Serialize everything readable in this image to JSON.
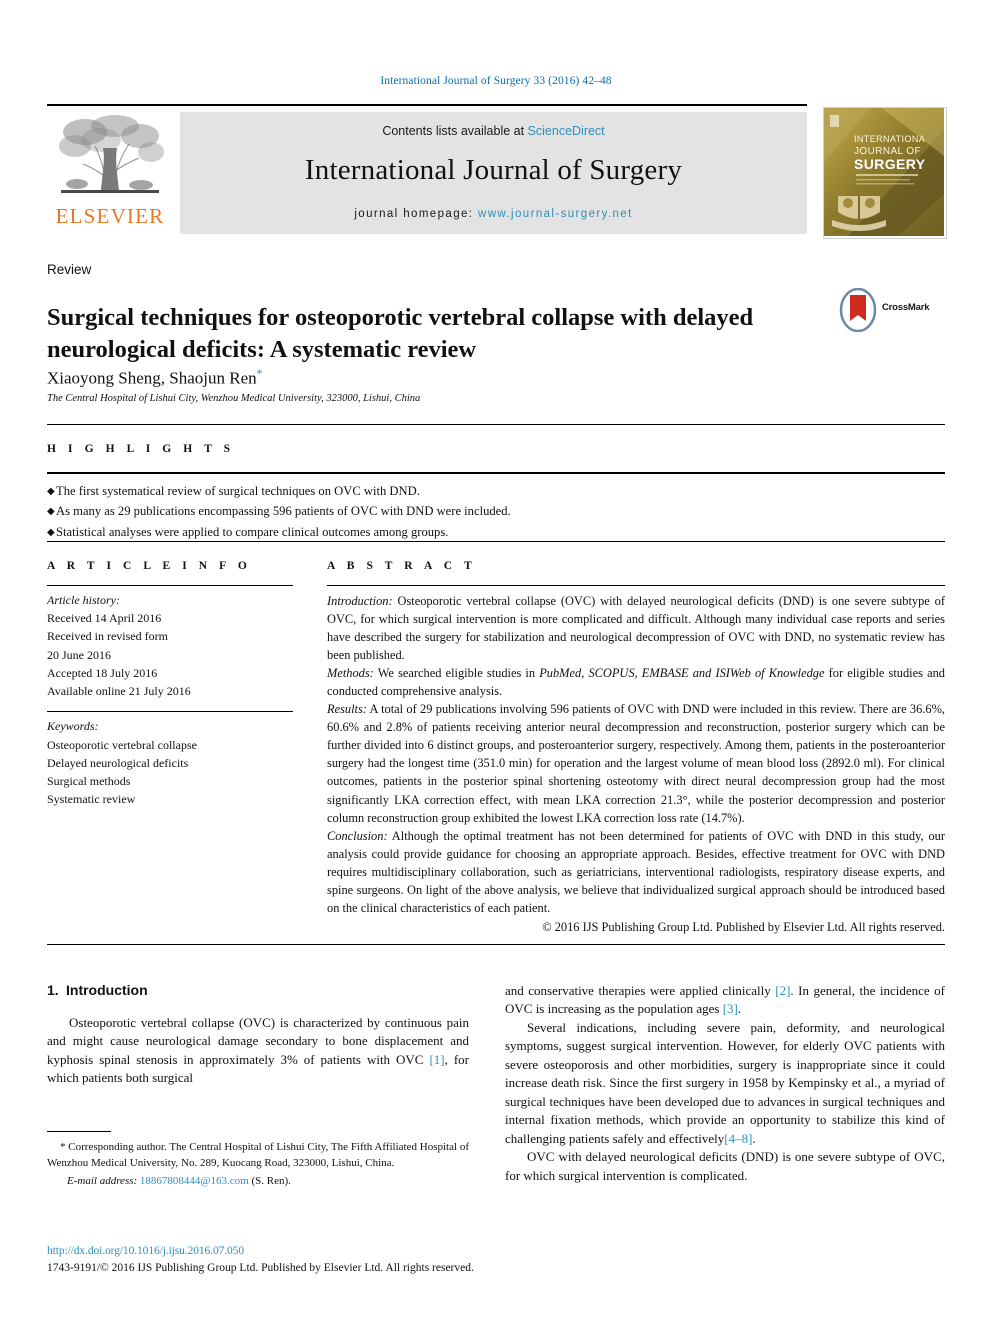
{
  "running_head": "International Journal of Surgery 33 (2016) 42–48",
  "masthead": {
    "contents_prefix": "Contents lists available at ",
    "sciencedirect": "ScienceDirect",
    "journal_title": "International Journal of Surgery",
    "homepage_prefix": "journal homepage: ",
    "homepage_url": "www.journal-surgery.net",
    "publisher_wordmark": "ELSEVIER",
    "publisher_color": "#e87722",
    "link_color": "#2c8fbf",
    "band_color": "#e3e3e3",
    "cover_title_line1": "INTERNATIONAL",
    "cover_title_line2": "JOURNAL OF",
    "cover_title_line3": "SURGERY"
  },
  "article": {
    "section_label": "Review",
    "title": "Surgical techniques for osteoporotic vertebral collapse with delayed neurological deficits: A systematic review",
    "authors": "Xiaoyong Sheng, Shaojun Ren",
    "corresponding_marker": "*",
    "affiliation": "The Central Hospital of Lishui City, Wenzhou Medical University, 323000, Lishui, China",
    "crossmark_label": "CrossMark"
  },
  "highlights": {
    "label": "H I G H L I G H T S",
    "items": [
      "The first systematical review of surgical techniques on OVC with DND.",
      "As many as 29 publications encompassing 596 patients of OVC with DND were included.",
      "Statistical analyses were applied to compare clinical outcomes among groups."
    ]
  },
  "article_info": {
    "label": "A R T I C L E   I N F O",
    "history_label": "Article history:",
    "history": [
      "Received 14 April 2016",
      "Received in revised form",
      "20 June 2016",
      "Accepted 18 July 2016",
      "Available online 21 July 2016"
    ],
    "keywords_label": "Keywords:",
    "keywords": [
      "Osteoporotic vertebral collapse",
      "Delayed neurological deficits",
      "Surgical methods",
      "Systematic review"
    ]
  },
  "abstract": {
    "label": "A B S T R A C T",
    "introduction_label": "Introduction:",
    "introduction_text": " Osteoporotic vertebral collapse (OVC) with delayed neurological deficits (DND) is one severe subtype of OVC, for which surgical intervention is more complicated and difficult. Although many individual case reports and series have described the surgery for stabilization and neurological decompression of OVC with DND, no systematic review has been published.",
    "methods_label": "Methods:",
    "methods_text_a": " We searched eligible studies in ",
    "methods_databases": "PubMed, SCOPUS, EMBASE and ISIWeb of Knowledge",
    "methods_text_b": " for eligible studies and conducted comprehensive analysis.",
    "results_label": "Results:",
    "results_text": " A total of 29 publications involving 596 patients of OVC with DND were included in this review. There are 36.6%, 60.6% and 2.8% of patients receiving anterior neural decompression and reconstruction, posterior surgery which can be further divided into 6 distinct groups, and posteroanterior surgery, respectively. Among them, patients in the posteroanterior surgery had the longest time (351.0 min) for operation and the largest volume of mean blood loss (2892.0 ml). For clinical outcomes, patients in the posterior spinal shortening osteotomy with direct neural decompression group had the most significantly LKA correction effect, with mean LKA correction 21.3°, while the posterior decompression and posterior column reconstruction group exhibited the lowest LKA correction loss rate (14.7%).",
    "conclusion_label": "Conclusion:",
    "conclusion_text": " Although the optimal treatment has not been determined for patients of OVC with DND in this study, our analysis could provide guidance for choosing an appropriate approach. Besides, effective treatment for OVC with DND requires multidisciplinary collaboration, such as geriatricians, interventional radiologists, respiratory disease experts, and spine surgeons. On light of the above analysis, we believe that individualized surgical approach should be introduced based on the clinical characteristics of each patient.",
    "copyright": "© 2016 IJS Publishing Group Ltd. Published by Elsevier Ltd. All rights reserved."
  },
  "body": {
    "intro_number": "1.",
    "intro_heading": "Introduction",
    "left_para1_a": "Osteoporotic vertebral collapse (OVC) is characterized by continuous pain and might cause neurological damage secondary to bone displacement and kyphosis spinal stenosis in approximately 3% of patients with OVC ",
    "left_para1_ref1": "[1]",
    "left_para1_b": ", for which patients both surgical",
    "right_para1_a": "and conservative therapies were applied clinically ",
    "right_para1_ref2": "[2]",
    "right_para1_b": ". In general, the incidence of OVC is increasing as the population ages ",
    "right_para1_ref3": "[3]",
    "right_para1_c": ".",
    "right_para2_a": "Several indications, including severe pain, deformity, and neurological symptoms, suggest surgical intervention. However, for elderly OVC patients with severe osteoporosis and other morbidities, surgery is inappropriate since it could increase death risk. Since the first surgery in 1958 by Kempinsky et al., a myriad of surgical techniques have been developed due to advances in surgical techniques and internal fixation methods, which provide an opportunity to stabilize this kind of challenging patients safely and effectively",
    "right_para2_ref48": "[4–8]",
    "right_para2_b": ".",
    "right_para3": "OVC with delayed neurological deficits (DND) is one severe subtype of OVC, for which surgical intervention is complicated."
  },
  "footnote": {
    "star": "*",
    "corresponding": " Corresponding author. The Central Hospital of Lishui City, The Fifth Affiliated Hospital of Wenzhou Medical University, No. 289, Kuocang Road, 323000, Lishui, China.",
    "email_label": "E-mail address:",
    "email": "18867808444@163.com",
    "email_suffix": " (S. Ren)."
  },
  "footer": {
    "doi": "http://dx.doi.org/10.1016/j.ijsu.2016.07.050",
    "issn_line": "1743-9191/© 2016 IJS Publishing Group Ltd. Published by Elsevier Ltd. All rights reserved."
  }
}
